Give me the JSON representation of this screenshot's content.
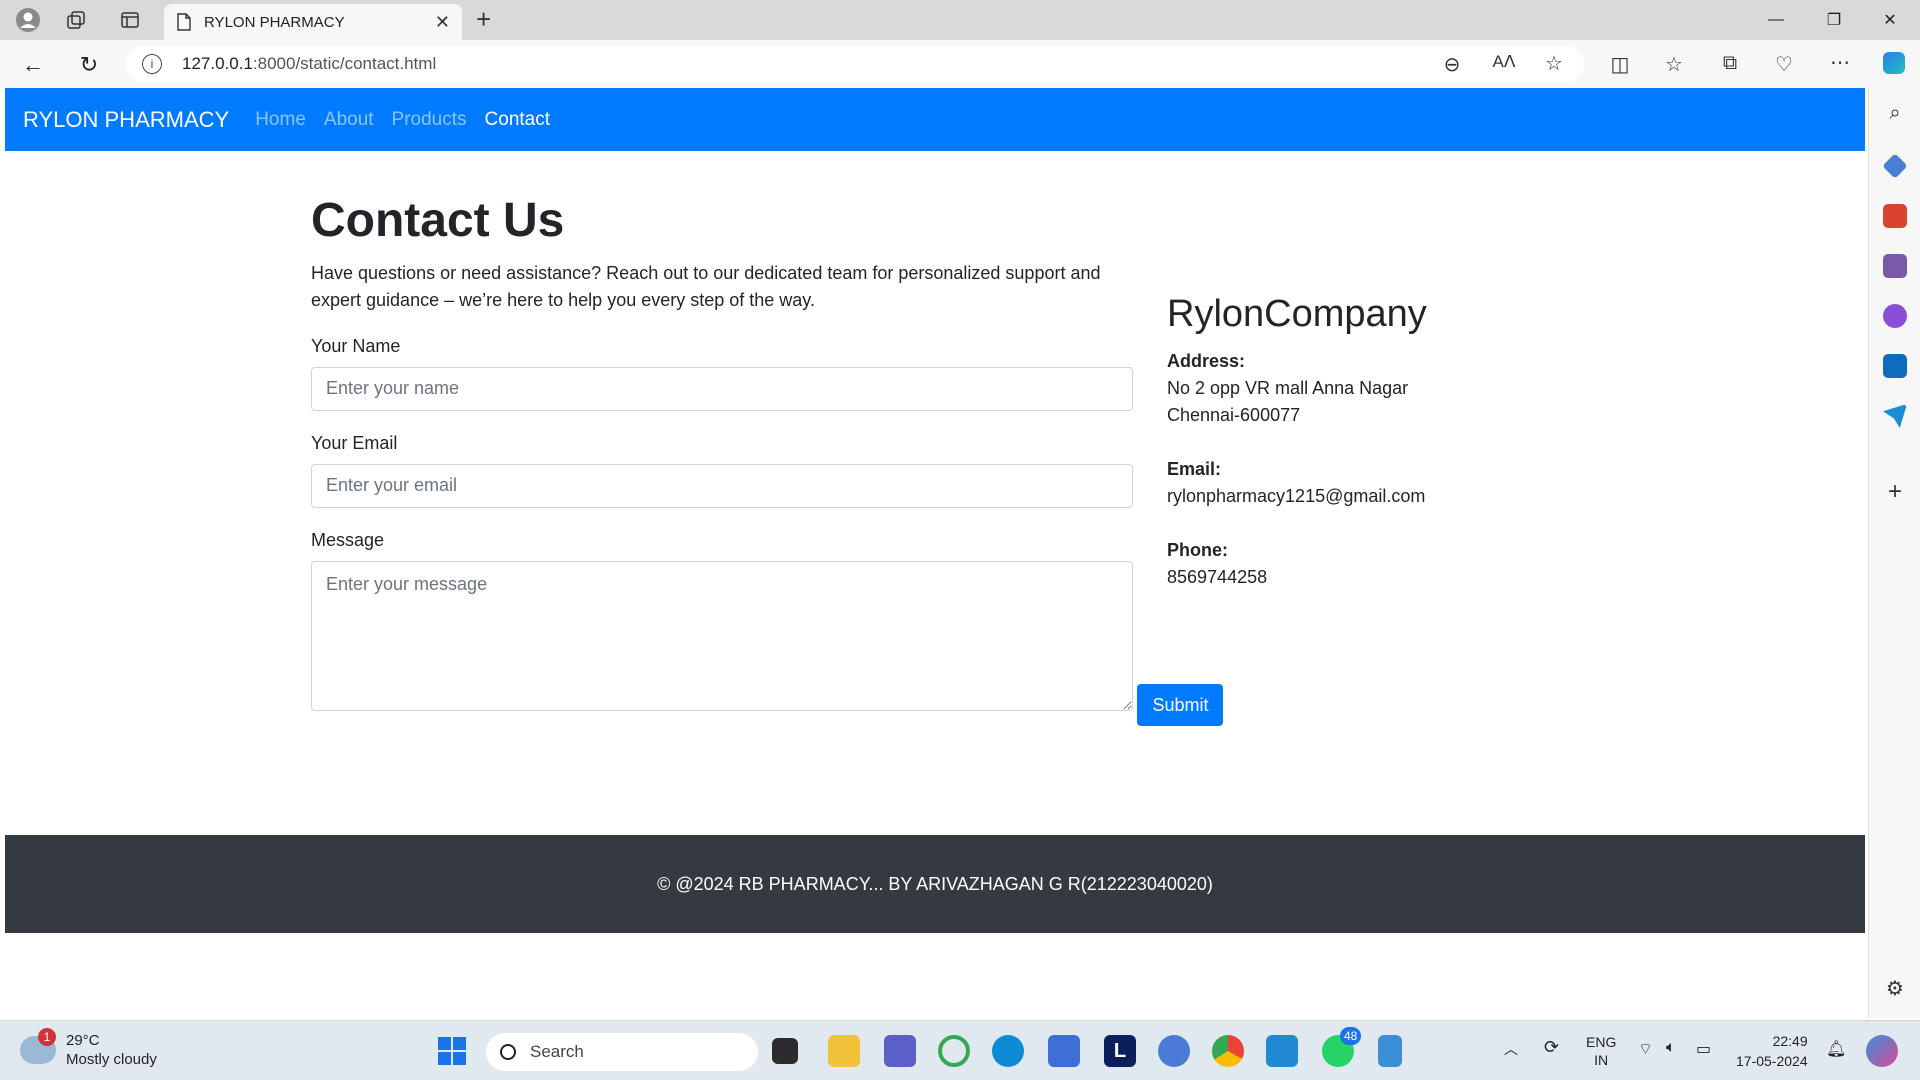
{
  "browser": {
    "tab_title": "RYLON PHARMACY",
    "url_host": "127.0.0.1",
    "url_path": ":8000/static/contact.html"
  },
  "navbar": {
    "brand": "RYLON PHARMACY",
    "links": [
      "Home",
      "About",
      "Products",
      "Contact"
    ],
    "active": "Contact",
    "color": "#007bff"
  },
  "contact": {
    "title": "Contact Us",
    "lead": "Have questions or need assistance? Reach out to our dedicated team for personalized support and expert guidance – we’re here to help you every step of the way.",
    "name_label": "Your Name",
    "name_placeholder": "Enter your name",
    "email_label": "Your Email",
    "email_placeholder": "Enter your email",
    "message_label": "Message",
    "message_placeholder": "Enter your message",
    "submit_label": "Submit"
  },
  "company": {
    "name": "RylonCompany",
    "address_label": "Address:",
    "address_line1": "No 2 opp VR mall Anna Nagar",
    "address_line2": "Chennai-600077",
    "email_label": "Email:",
    "email": "rylonpharmacy1215@gmail.com",
    "phone_label": "Phone:",
    "phone": "8569744258"
  },
  "footer": {
    "text": "© @2024 RB PHARMACY... BY ARIVAZHAGAN G R(212223040020)",
    "color": "#343a40"
  },
  "taskbar": {
    "weather_temp": "29°C",
    "weather_desc": "Mostly cloudy",
    "weather_badge": "1",
    "search_label": "Search",
    "whatsapp_badge": "48",
    "lang_line1": "ENG",
    "lang_line2": "IN",
    "time": "22:49",
    "date": "17-05-2024"
  }
}
